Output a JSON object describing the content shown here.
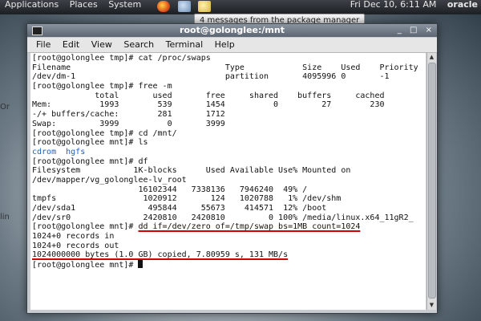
{
  "panel": {
    "menu": [
      "Applications",
      "Places",
      "System"
    ],
    "clock": "Fri Dec 10,  6:11 AM",
    "user": "oracle"
  },
  "notification": "4 messages from the package manager",
  "desktop": {
    "label_left": "Or",
    "label_left2": "lin"
  },
  "window": {
    "title": "root@golonglee:/mnt",
    "controls": [
      "_",
      "□",
      "×"
    ],
    "menu": [
      "File",
      "Edit",
      "View",
      "Search",
      "Terminal",
      "Help"
    ]
  },
  "terminal": {
    "lines": [
      "[root@golonglee tmp]# cat /proc/swaps",
      "Filename                                Type            Size    Used    Priority",
      "/dev/dm-1                               partition       4095996 0       -1",
      "[root@golonglee tmp]# free -m",
      "             total       used       free     shared    buffers     cached",
      "Mem:          1993        539       1454          0         27        230",
      "-/+ buffers/cache:        281       1712",
      "Swap:         3999          0       3999",
      "[root@golonglee tmp]# cd /mnt/",
      "[root@golonglee mnt]# ls",
      "cdrom  hgfs",
      "[root@golonglee mnt]# df",
      "Filesystem           1K-blocks      Used Available Use% Mounted on",
      "/dev/mapper/vg_golonglee-lv_root",
      "                      16102344   7338136   7946240  49% /",
      "tmpfs                  1020912       124   1020788   1% /dev/shm",
      "/dev/sda1               495844     55673    414571  12% /boot",
      "/dev/sr0               2420810   2420810         0 100% /media/linux.x64_11gR2_",
      "[root@golonglee mnt]# dd if=/dev/zero of=/tmp/swap bs=1MB count=1024",
      "1024+0 records in",
      "1024+0 records out",
      "1024000000 bytes (1.0 GB) copied, 7.80959 s, 131 MB/s",
      "[root@golonglee mnt]# "
    ],
    "dir_listing_line": 10,
    "underlined": [
      {
        "line": 18,
        "text": "dd if=/dev/zero of=/tmp/swap bs=1MB count=1024"
      },
      {
        "line": 21,
        "text": "1024000000 bytes (1.0 GB) copied, 7.80959 s, 131 MB/s"
      }
    ]
  },
  "colors": {
    "highlight_underline": "#d40000",
    "directory_text": "#2060c0",
    "title_bar": "#6d7785"
  },
  "icons": [
    "terminal-icon",
    "minimize-icon",
    "maximize-icon",
    "close-icon",
    "scroll-up-icon",
    "scroll-down-icon"
  ]
}
